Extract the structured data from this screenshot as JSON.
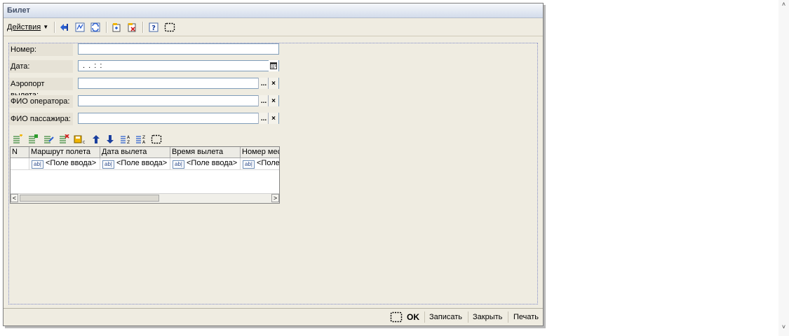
{
  "window": {
    "title": "Билет"
  },
  "toolbar": {
    "actions_label": "Действия",
    "icons": [
      "navigate-back-icon",
      "structure-icon",
      "refresh-icon",
      "open-icon",
      "delete-icon",
      "help-icon",
      "select-area-icon"
    ]
  },
  "fields": [
    {
      "label": "Номер:",
      "value": "",
      "has_select": false,
      "has_clear": false,
      "has_calendar": false
    },
    {
      "label": "Дата:",
      "value": ". .   : :",
      "has_select": false,
      "has_clear": false,
      "has_calendar": true
    },
    {
      "label": "Аэропорт вылета:",
      "value": "",
      "has_select": true,
      "has_clear": true,
      "has_calendar": false
    },
    {
      "label": "ФИО оператора:",
      "value": "",
      "has_select": true,
      "has_clear": true,
      "has_calendar": false
    },
    {
      "label": "ФИО пассажира:",
      "value": "",
      "has_select": true,
      "has_clear": true,
      "has_calendar": false
    }
  ],
  "table": {
    "columns": [
      "N",
      "Маршрут полета",
      "Дата вылета",
      "Время вылета",
      "Номер места"
    ],
    "rows": [
      [
        "",
        "<Поле ввода>",
        "<Поле ввода>",
        "<Поле ввода>",
        "<Поле ввода>"
      ]
    ],
    "cell_tag": "ab|"
  },
  "buttons": {
    "select_label": "...",
    "clear_label": "×",
    "ok": "OK",
    "save": "Записать",
    "close": "Закрыть",
    "print": "Печать"
  },
  "scroll": {
    "left_arrow": "<",
    "right_arrow": ">",
    "up_arrow": "˄",
    "down_arrow": "˅"
  },
  "colors": {
    "window_bg": "#efece1",
    "title_text": "#44516a",
    "frame_border": "#7f88c6"
  }
}
